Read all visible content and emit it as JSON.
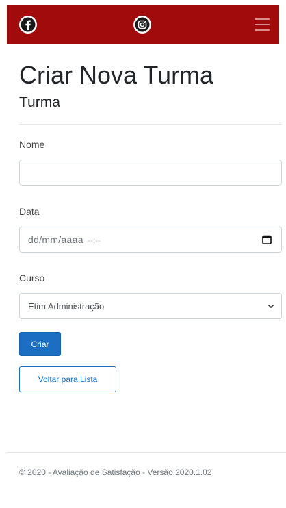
{
  "navbar": {
    "background": "#a10b0b",
    "icons": [
      "facebook-icon",
      "instagram-icon",
      "hamburger-menu-icon"
    ]
  },
  "page": {
    "title": "Criar Nova Turma",
    "subtitle": "Turma"
  },
  "form": {
    "nome": {
      "label": "Nome",
      "value": ""
    },
    "data": {
      "label": "Data",
      "placeholder_date": "dd/mm/aaaa",
      "placeholder_time": "--:--"
    },
    "curso": {
      "label": "Curso",
      "selected": "Etim Administração"
    },
    "submit_label": "Criar",
    "back_label": "Voltar para Lista"
  },
  "footer": {
    "text": "© 2020 - Avaliação de Satisfação - Versão:2020.1.02"
  },
  "colors": {
    "primary": "#1b6ec2",
    "navbar": "#a10b0b"
  }
}
